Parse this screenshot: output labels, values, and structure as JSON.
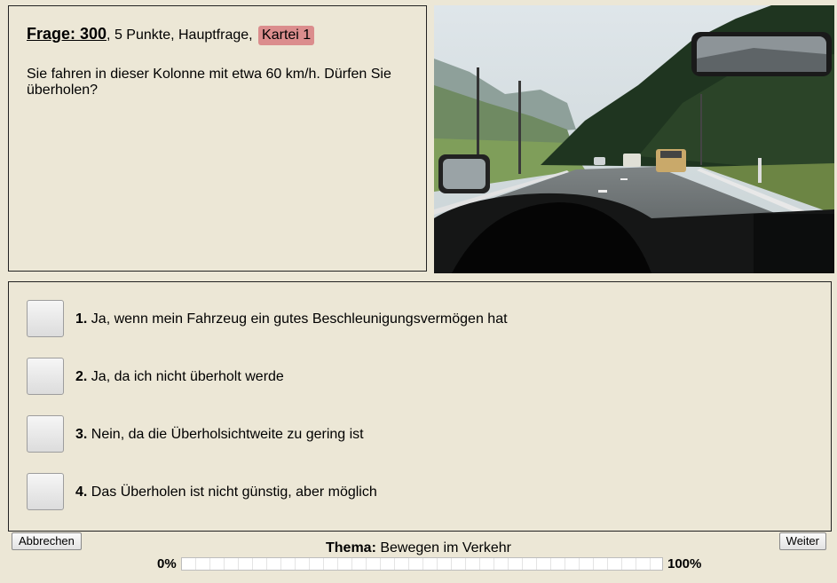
{
  "question": {
    "number_label": "Frage: 300",
    "meta": ", 5 Punkte, Hauptfrage, ",
    "card_label": "Kartei 1",
    "text": "Sie fahren in dieser Kolonne mit etwa 60 km/h. Dürfen Sie überholen?"
  },
  "answers": [
    {
      "num": "1.",
      "text": "Ja, wenn mein Fahrzeug ein gutes Beschleunigungsvermögen hat"
    },
    {
      "num": "2.",
      "text": "Ja, da ich nicht überholt werde"
    },
    {
      "num": "3.",
      "text": "Nein, da die Überholsichtweite zu gering ist"
    },
    {
      "num": "4.",
      "text": "Das Überholen ist nicht günstig, aber möglich"
    }
  ],
  "footer": {
    "cancel_label": "Abbrechen",
    "next_label": "Weiter",
    "thema_label": "Thema:",
    "thema_value": "Bewegen im Verkehr",
    "progress_min": "0%",
    "progress_max": "100%",
    "progress_value": 0
  },
  "colors": {
    "background": "#ece7d6",
    "card_badge": "#db8d8d"
  }
}
